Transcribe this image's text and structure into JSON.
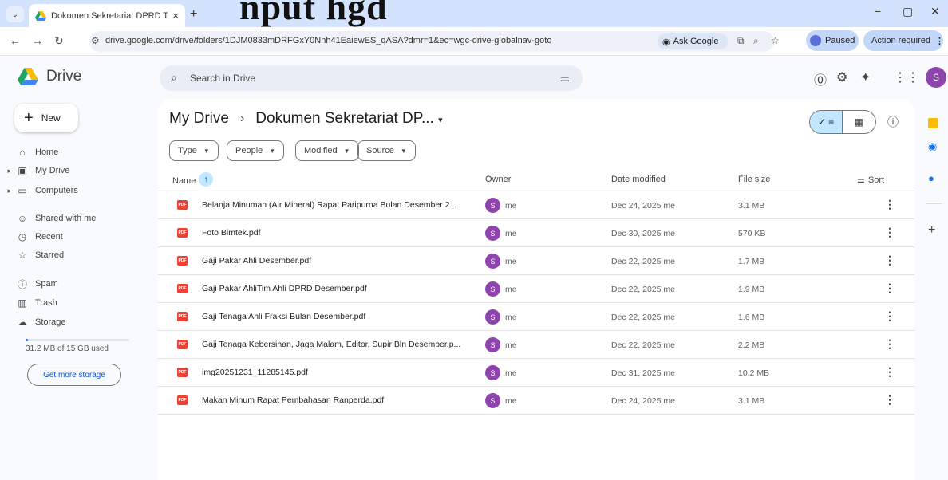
{
  "browser": {
    "tab_title": "Dokumen Sekretariat DPRD Ta",
    "tab_close": "×",
    "new_tab": "+",
    "headline_overlay": "nput hgd",
    "url": "drive.google.com/drive/folders/1DJM0833mDRFGxY0Nnh41EaiewES_qASA?dmr=1&ec=wgc-drive-globalnav-goto",
    "ask_google": "Ask Google",
    "profile_status": "Paused",
    "action_required": "Action required",
    "minimize": "−",
    "restore": "▢",
    "close": "✕"
  },
  "drive": {
    "logo_text": "Drive",
    "search_placeholder": "Search in Drive",
    "avatar_initial": "S"
  },
  "sidebar": {
    "new_label": "New",
    "items": [
      {
        "label": "Home",
        "icon": "home-icon",
        "glyph": "⌂"
      },
      {
        "label": "My Drive",
        "icon": "my-drive-icon",
        "glyph": "▣"
      },
      {
        "label": "Computers",
        "icon": "computers-icon",
        "glyph": "▭"
      },
      {
        "label": "Shared with me",
        "icon": "shared-icon",
        "glyph": "👥"
      },
      {
        "label": "Recent",
        "icon": "recent-icon",
        "glyph": "◷"
      },
      {
        "label": "Starred",
        "icon": "star-icon",
        "glyph": "☆"
      },
      {
        "label": "Spam",
        "icon": "spam-icon",
        "glyph": "ⓘ"
      },
      {
        "label": "Trash",
        "icon": "trash-icon",
        "glyph": "🗑"
      },
      {
        "label": "Storage",
        "icon": "cloud-icon",
        "glyph": "☁"
      }
    ],
    "storage_text": "31.2 MB of 15 GB used",
    "storage_fraction": 0.002,
    "get_more_storage": "Get more storage"
  },
  "main": {
    "breadcrumb_root": "My Drive",
    "breadcrumb_sep": "›",
    "breadcrumb_current": "Dokumen Sekretariat DP...",
    "filters": [
      "Type",
      "People",
      "Modified",
      "Source"
    ],
    "columns": {
      "name": "Name",
      "owner": "Owner",
      "date": "Date modified",
      "size": "File size",
      "sort": "Sort"
    },
    "files": [
      {
        "name": "Belanja Minuman (Air Mineral) Rapat Paripurna Bulan Desember 2...",
        "owner": "me",
        "date": "Dec 24, 2025 me",
        "size": "3.1 MB"
      },
      {
        "name": "Foto Bimtek.pdf",
        "owner": "me",
        "date": "Dec 30, 2025 me",
        "size": "570 KB"
      },
      {
        "name": "Gaji Pakar Ahli Desember.pdf",
        "owner": "me",
        "date": "Dec 22, 2025 me",
        "size": "1.7 MB"
      },
      {
        "name": "Gaji Pakar AhliTim Ahli DPRD Desember.pdf",
        "owner": "me",
        "date": "Dec 22, 2025 me",
        "size": "1.9 MB"
      },
      {
        "name": "Gaji Tenaga Ahli Fraksi Bulan Desember.pdf",
        "owner": "me",
        "date": "Dec 22, 2025 me",
        "size": "1.6 MB"
      },
      {
        "name": "Gaji Tenaga Kebersihan, Jaga Malam, Editor, Supir Bln Desember.p...",
        "owner": "me",
        "date": "Dec 22, 2025 me",
        "size": "2.2 MB"
      },
      {
        "name": "img20251231_11285145.pdf",
        "owner": "me",
        "date": "Dec 31, 2025 me",
        "size": "10.2 MB"
      },
      {
        "name": "Makan Minum Rapat Pembahasan Ranperda.pdf",
        "owner": "me",
        "date": "Dec 24, 2025 me",
        "size": "3.1 MB"
      }
    ]
  },
  "colors": {
    "accent": "#0b57d0",
    "pdf_red": "#ea4335",
    "avatar_purple": "#8e44ad"
  }
}
